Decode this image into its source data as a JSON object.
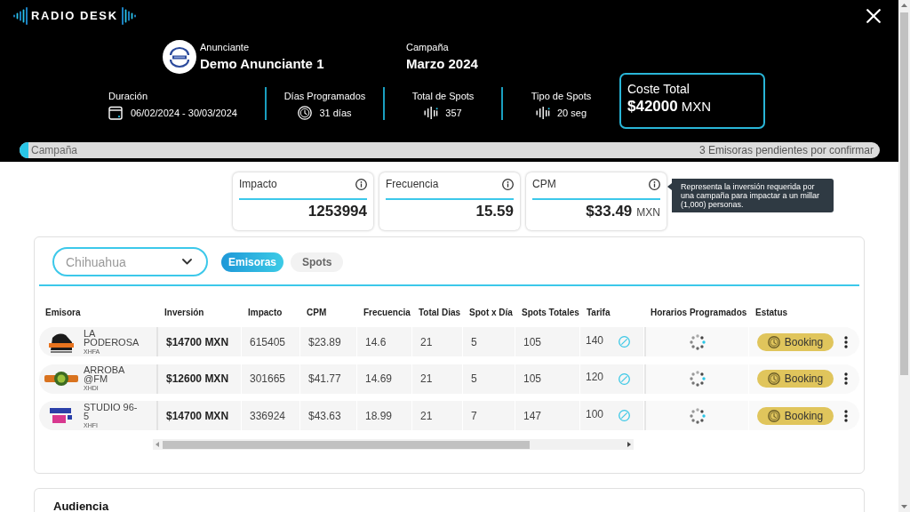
{
  "header": {
    "logo": "RADIO DESK"
  },
  "advertiser": {
    "label": "Anunciante",
    "name": "Demo Anunciante 1"
  },
  "campaign": {
    "label": "Campaña",
    "name": "Marzo 2024"
  },
  "stats": [
    {
      "kind": "period",
      "label": "Duración",
      "value": "06/02/2024 - 30/03/2024"
    },
    {
      "kind": "days",
      "label": "Días Programados",
      "value": "31 días"
    },
    {
      "kind": "count",
      "label": "Total de Spots",
      "value": "357"
    },
    {
      "kind": "length",
      "label": "Tipo de Spots",
      "value": "20 seg"
    }
  ],
  "total_cost": {
    "label": "Coste Total",
    "amount": "$42000",
    "currency": "MXN"
  },
  "progress": {
    "label": "Campaña",
    "level": 0.01,
    "note": "3 Emisoras pendientes por confirmar"
  },
  "metrics": [
    {
      "label": "Impacto",
      "value": "1253994"
    },
    {
      "label": "Frecuencia",
      "value": "15.59"
    },
    {
      "label": "CPM",
      "value": "$33.49",
      "unit": "MXN"
    }
  ],
  "tooltip": {
    "text": "Representa la inversión requerida por una campaña para impactar a un millar (1,000) personas."
  },
  "filter": {
    "value": "Chihuahua"
  },
  "tabs": [
    {
      "label": "Emisoras",
      "selected": true
    },
    {
      "label": "Spots",
      "selected": false
    }
  ],
  "table": {
    "columns": [
      "Emisora",
      "Inversión",
      "Impacto",
      "CPM",
      "Frecuencia",
      "Total Dias",
      "Spot x Día",
      "Spots Totales",
      "Tarifa",
      "Horarios Programados",
      "Estatus"
    ],
    "rows": [
      {
        "name": "LA PODEROSA",
        "callsign": "XHFA",
        "investment": "$14700 MXN",
        "impact": "615405",
        "cpm": "$23.89",
        "frequency": "14.6",
        "total_days": "21",
        "spots_per_day": "5",
        "total_spots": "105",
        "rate": "140",
        "status": "Booking"
      },
      {
        "name": "ARROBA @FM",
        "callsign": "XHDI",
        "investment": "$12600 MXN",
        "impact": "301665",
        "cpm": "$41.77",
        "frequency": "14.69",
        "total_days": "21",
        "spots_per_day": "5",
        "total_spots": "105",
        "rate": "120",
        "status": "Booking"
      },
      {
        "name": "STUDIO 96-5",
        "callsign": "XHFI",
        "investment": "$14700 MXN",
        "impact": "336924",
        "cpm": "$43.63",
        "frequency": "18.99",
        "total_days": "21",
        "spots_per_day": "7",
        "total_spots": "147",
        "rate": "100",
        "status": "Booking"
      }
    ]
  },
  "audience": {
    "title": "Audiencia"
  }
}
